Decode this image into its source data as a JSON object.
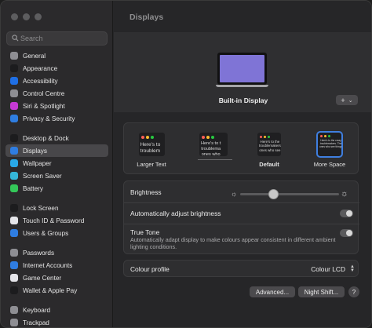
{
  "sidebar": {
    "search_placeholder": "Search",
    "groups": [
      [
        {
          "label": "General",
          "icon": "general-icon",
          "color": "#8e8e93"
        },
        {
          "label": "Appearance",
          "icon": "appearance-icon",
          "color": "#1c1c1e"
        },
        {
          "label": "Accessibility",
          "icon": "accessibility-icon",
          "color": "#1f6fe5"
        },
        {
          "label": "Control Centre",
          "icon": "control-centre-icon",
          "color": "#8e8e93"
        },
        {
          "label": "Siri & Spotlight",
          "icon": "siri-icon",
          "color": "#c53ad4"
        },
        {
          "label": "Privacy & Security",
          "icon": "privacy-hand-icon",
          "color": "#2f7de1"
        }
      ],
      [
        {
          "label": "Desktop & Dock",
          "icon": "desktop-dock-icon",
          "color": "#1c1c1e"
        },
        {
          "label": "Displays",
          "icon": "displays-icon",
          "color": "#2f7de1",
          "active": true
        },
        {
          "label": "Wallpaper",
          "icon": "wallpaper-icon",
          "color": "#29a9e8"
        },
        {
          "label": "Screen Saver",
          "icon": "screen-saver-icon",
          "color": "#35b7d9"
        },
        {
          "label": "Battery",
          "icon": "battery-icon",
          "color": "#34c759"
        }
      ],
      [
        {
          "label": "Lock Screen",
          "icon": "lock-screen-icon",
          "color": "#1c1c1e"
        },
        {
          "label": "Touch ID & Password",
          "icon": "fingerprint-icon",
          "color": "#e5e5ea"
        },
        {
          "label": "Users & Groups",
          "icon": "users-groups-icon",
          "color": "#2f7de1"
        }
      ],
      [
        {
          "label": "Passwords",
          "icon": "passwords-key-icon",
          "color": "#8e8e93"
        },
        {
          "label": "Internet Accounts",
          "icon": "internet-accounts-icon",
          "color": "#2f7de1"
        },
        {
          "label": "Game Center",
          "icon": "game-center-icon",
          "color": "#e5e5ea"
        },
        {
          "label": "Wallet & Apple Pay",
          "icon": "wallet-icon",
          "color": "#1c1c1e"
        }
      ],
      [
        {
          "label": "Keyboard",
          "icon": "keyboard-icon",
          "color": "#8e8e93"
        },
        {
          "label": "Trackpad",
          "icon": "trackpad-icon",
          "color": "#8e8e93"
        }
      ]
    ]
  },
  "main": {
    "title": "Displays",
    "display_name": "Built-in Display",
    "add_button": "+",
    "resolutions": [
      {
        "label": "Larger Text",
        "preview": "Here's to\ntroublem"
      },
      {
        "label": "",
        "preview": "Here's to t\ntroublema\nones who"
      },
      {
        "label": "Default",
        "preview": "Here's to the\ntroublemakers\nones who see"
      },
      {
        "label": "More Space",
        "preview": "Here's to the crazy\ntroublemakers. The\nones who see things"
      }
    ],
    "brightness_label": "Brightness",
    "brightness_level": 0.33,
    "auto_brightness_label": "Automatically adjust brightness",
    "true_tone_label": "True Tone",
    "true_tone_desc": "Automatically adapt display to make colours appear consistent in different ambient lighting conditions.",
    "colour_profile_label": "Colour profile",
    "colour_profile_value": "Colour LCD",
    "advanced_button": "Advanced...",
    "night_shift_button": "Night Shift...",
    "help_button": "?"
  },
  "colors": {
    "accent": "#3f7fe0",
    "wallpaper": "#7f74d6"
  }
}
